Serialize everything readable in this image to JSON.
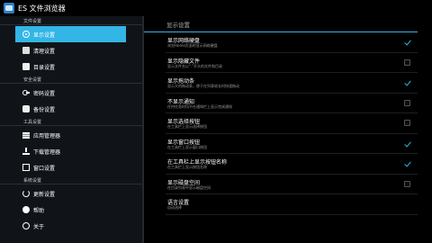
{
  "app": {
    "title": "ES 文件浏览器"
  },
  "sidebar": {
    "sections": [
      {
        "header": "文件设置",
        "items": [
          {
            "label": "显示设置",
            "icon": "display-settings-icon",
            "selected": true
          },
          {
            "label": "清理设置",
            "icon": "clean-icon"
          },
          {
            "label": "目录设置",
            "icon": "directory-icon"
          }
        ]
      },
      {
        "header": "安全设置",
        "items": [
          {
            "label": "密码设置",
            "icon": "key-icon"
          },
          {
            "label": "备份设置",
            "icon": "backup-icon"
          }
        ]
      },
      {
        "header": "工具设置",
        "items": [
          {
            "label": "应用管理器",
            "icon": "app-manager-icon"
          },
          {
            "label": "下载管理器",
            "icon": "download-icon"
          },
          {
            "label": "窗口设置",
            "icon": "window-icon"
          }
        ]
      },
      {
        "header": "系统设置",
        "items": [
          {
            "label": "更新设置",
            "icon": "update-icon"
          },
          {
            "label": "帮助",
            "icon": "help-icon"
          },
          {
            "label": "关于",
            "icon": "about-icon"
          }
        ]
      }
    ]
  },
  "content": {
    "header": "显示设置",
    "settings": [
      {
        "title": "显示网络硬盘",
        "desc": "浏览Home页面时显示网络硬盘",
        "checked": true
      },
      {
        "title": "显示隐藏文件",
        "desc": "显示文件名以\".\"开头的文件和目录",
        "checked": false
      },
      {
        "title": "显示拖动条",
        "desc": "显示大的拖动条，便于在列表较长时快速拖动",
        "checked": true
      },
      {
        "title": "不显示通知",
        "desc": "任何任务时均不在通知栏上显示完成通知",
        "checked": false
      },
      {
        "title": "显示选择按钮",
        "desc": "在工具栏上显示选择按钮",
        "checked": false
      },
      {
        "title": "显示窗口按钮",
        "desc": "在工具栏上显示窗口按钮",
        "checked": true
      },
      {
        "title": "在工具栏上显示按钮名称",
        "desc": "在工具栏上显示按钮名称",
        "checked": true
      },
      {
        "title": "显示磁盘空间",
        "desc": "在目录列表中显示磁盘空间",
        "checked": false
      },
      {
        "title": "语言设置",
        "desc": "自动选择",
        "checked": null
      }
    ]
  },
  "colors": {
    "accent": "#33b5e5",
    "sidebar_bg": "#101418",
    "content_bg": "#000000"
  }
}
